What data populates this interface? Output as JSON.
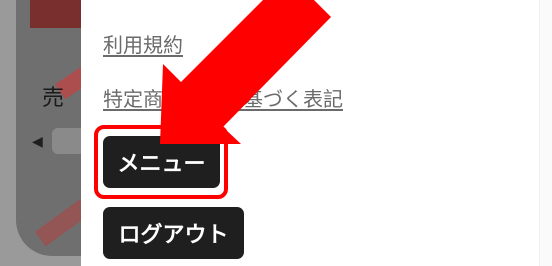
{
  "background": {
    "label": "売",
    "arrow_glyph": "◀"
  },
  "drawer": {
    "links": {
      "terms": "利用規約",
      "legal": "特定商取引法に基づく表記"
    },
    "buttons": {
      "menu": "メニュー",
      "logout": "ログアウト"
    }
  },
  "colors": {
    "highlight": "#ff0000",
    "button_bg": "#1f1f1f",
    "link_text": "#6b6b6b"
  }
}
